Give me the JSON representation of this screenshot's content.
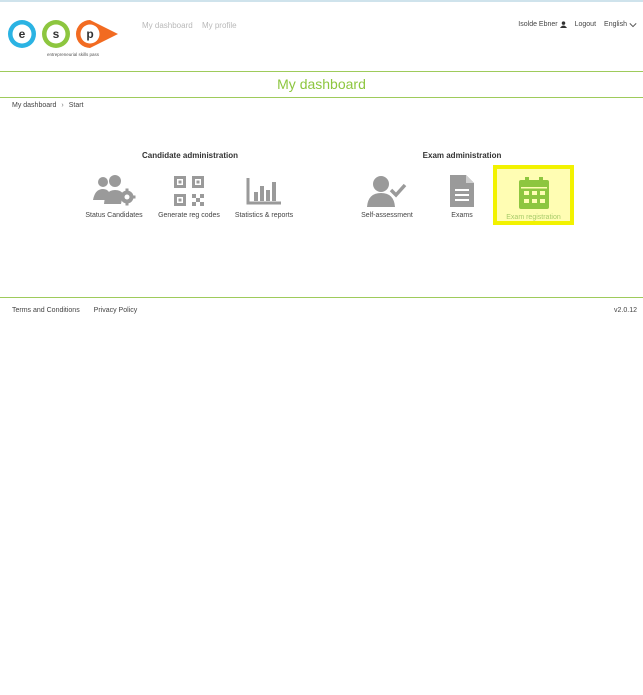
{
  "logo": {
    "letters": [
      "e",
      "s",
      "p"
    ],
    "tagline": "entrepreneurial skills pass"
  },
  "top_nav": {
    "dashboard": "My dashboard",
    "profile": "My profile"
  },
  "user_bar": {
    "user_name": "Isolde Ebner",
    "logout": "Logout",
    "language": "English"
  },
  "page_title": "My dashboard",
  "breadcrumb": {
    "first": "My dashboard",
    "separator": "›",
    "second": "Start"
  },
  "candidate_admin": {
    "title": "Candidate administration",
    "tiles": [
      {
        "label": "Status Candidates",
        "icon": "users-gear-icon"
      },
      {
        "label": "Generate reg codes",
        "icon": "qr-code-icon"
      },
      {
        "label": "Statistics & reports",
        "icon": "bar-chart-icon"
      }
    ]
  },
  "exam_admin": {
    "title": "Exam administration",
    "tiles": [
      {
        "label": "Self-assessment",
        "icon": "user-check-icon"
      },
      {
        "label": "Exams",
        "icon": "document-icon"
      },
      {
        "label": "Exam registration",
        "icon": "calendar-icon",
        "highlighted": true
      }
    ]
  },
  "footer": {
    "terms": "Terms and Conditions",
    "privacy": "Privacy Policy",
    "version": "v2.0.12"
  },
  "colors": {
    "accent_green": "#8dc63f",
    "icon_gray": "#9a9a9a",
    "highlight": "#f2f200",
    "logo_blue": "#2bb3e3",
    "logo_orange": "#f26b21"
  }
}
